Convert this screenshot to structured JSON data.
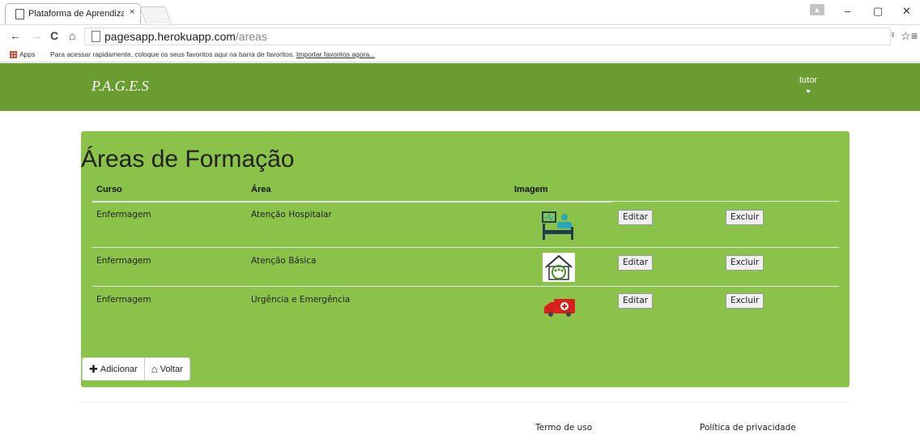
{
  "browser": {
    "tab_title": "Plataforma de Aprendizagem",
    "tab_close": "×",
    "url_host": "pagesapp.herokuapp.com",
    "url_path": "/areas",
    "apps_label": "Apps",
    "bookmarks_message": "Para acessar rapidamente, coloque os seus favoritos aqui na barra de favoritos.",
    "bookmarks_import": "Importar favoritos agora..."
  },
  "header": {
    "brand": "P.A.G.E.S",
    "user": "tutor"
  },
  "page": {
    "title": "Áreas de Formação",
    "columns": {
      "curso": "Curso",
      "area": "Área",
      "imagem": "Imagem"
    },
    "rows": [
      {
        "curso": "Enfermagem",
        "area": "Atenção Hospitalar",
        "image_icon": "hospital-bed-icon",
        "edit": "Editar",
        "delete": "Excluir"
      },
      {
        "curso": "Enfermagem",
        "area": "Atenção Básica",
        "image_icon": "family-house-icon",
        "edit": "Editar",
        "delete": "Excluir"
      },
      {
        "curso": "Enfermagem",
        "area": "Urgência e Emergência",
        "image_icon": "ambulance-icon",
        "edit": "Editar",
        "delete": "Excluir"
      }
    ],
    "add_label": "Adicionar",
    "back_label": "Voltar"
  },
  "footer": {
    "terms": "Termo de uso",
    "privacy": "Política de privacidade"
  },
  "colors": {
    "header": "#6a9c32",
    "panel": "#8bc34a"
  }
}
